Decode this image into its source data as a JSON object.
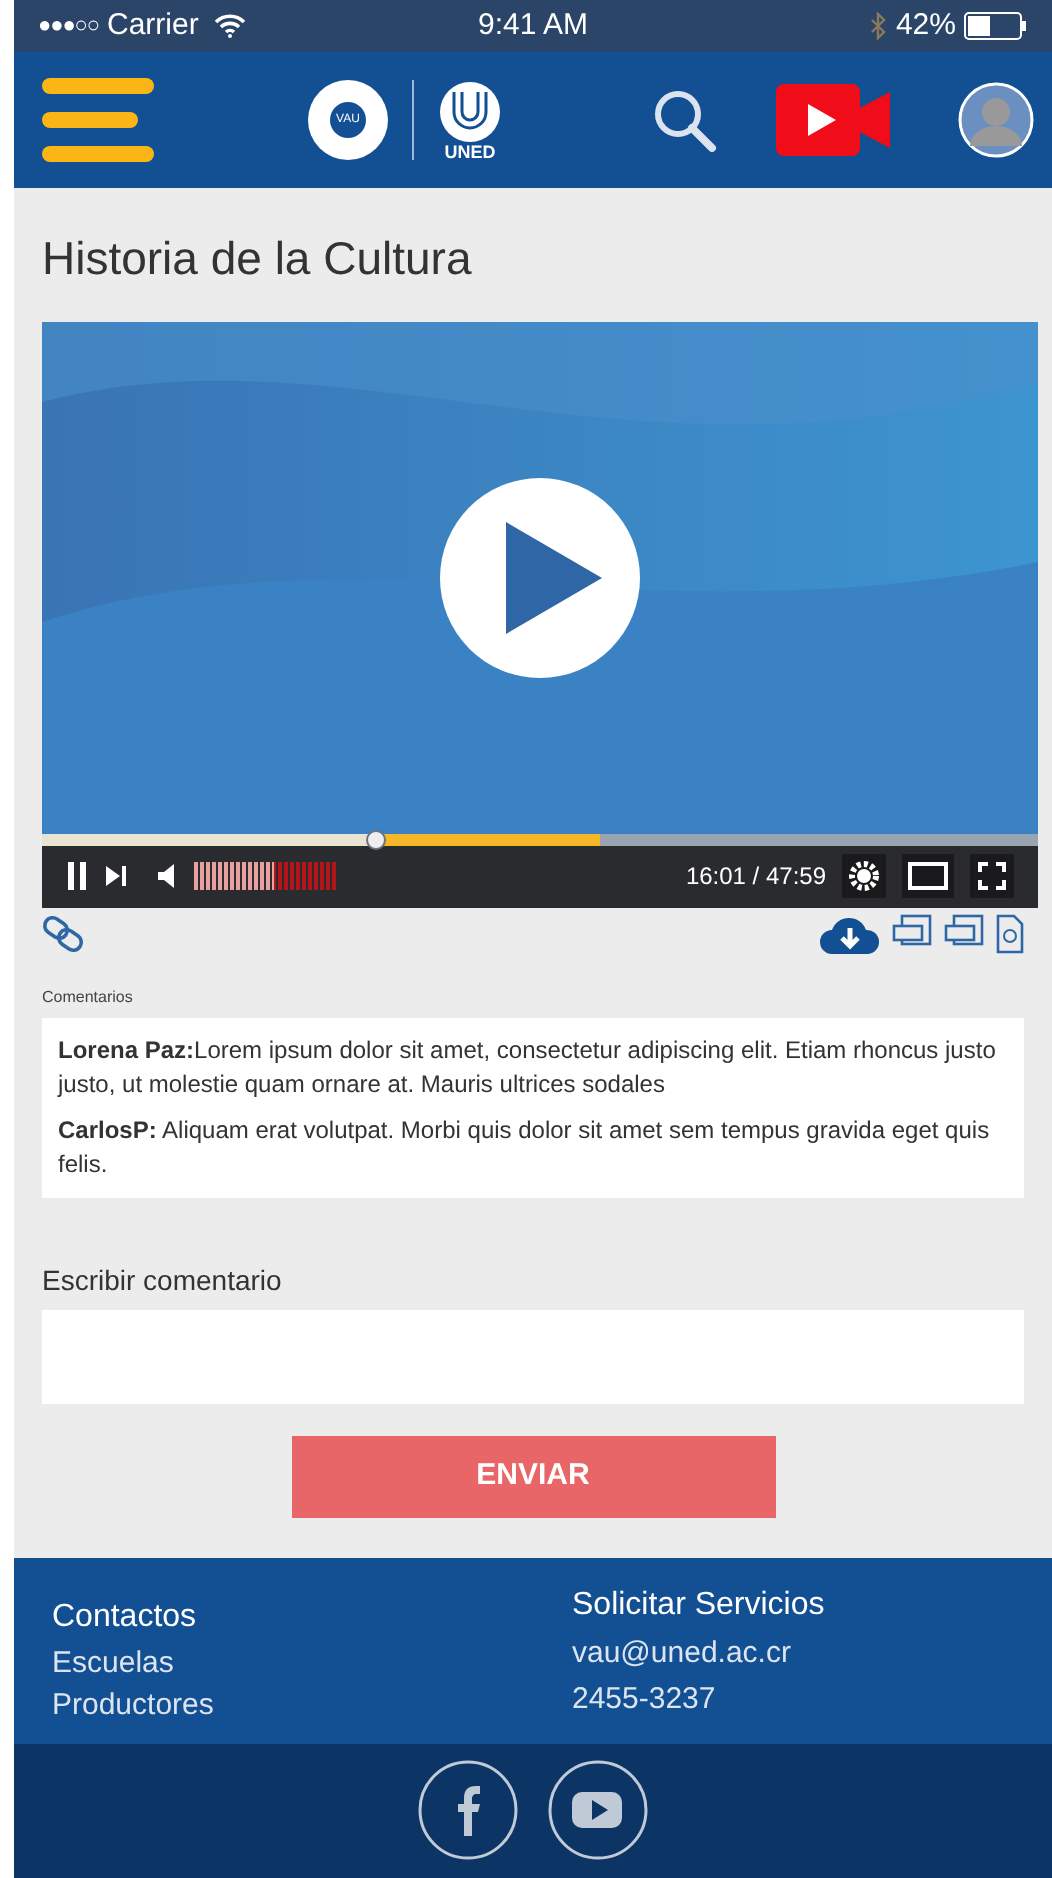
{
  "status_bar": {
    "signal": "●●●○○",
    "carrier": "Carrier",
    "time": "9:41 AM",
    "battery": "42%"
  },
  "header": {
    "logo_text": "VAU",
    "brand": "UNED"
  },
  "page_title": "Historia de la Cultura",
  "video": {
    "played": {
      "level": 0.335
    },
    "buffered": {
      "level": 0.56
    },
    "volume": {
      "level": 0.55
    },
    "time": "16:01 / 47:59"
  },
  "comments_label": "Comentarios",
  "comments": [
    {
      "author": "Lorena Paz:",
      "text": "Lorem ipsum dolor sit amet, consectetur adipiscing elit. Etiam rhoncus justo justo, ut molestie quam ornare at. Mauris ultrices sodales"
    },
    {
      "author": "CarlosP:",
      "text": " Aliquam erat volutpat. Morbi quis dolor sit amet sem tempus gravida eget quis felis."
    }
  ],
  "comment_field": {
    "label": "Escribir comentario"
  },
  "submit_button": "ENVIAR",
  "footer": {
    "left": {
      "title": "Contactos",
      "links": [
        "Escuelas",
        "Productores"
      ]
    },
    "right": {
      "title": "Solicitar Servicios",
      "links": [
        "vau@uned.ac.cr",
        "2455-3237"
      ]
    }
  }
}
